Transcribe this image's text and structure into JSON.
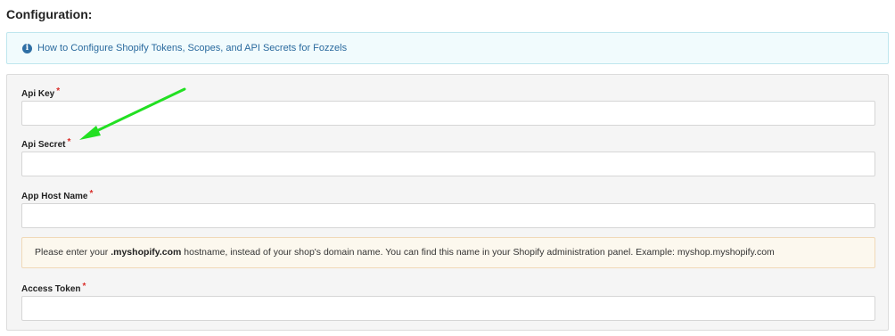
{
  "section": {
    "title": "Configuration:"
  },
  "info": {
    "icon": "info-icon",
    "link_text": "How to Configure Shopify Tokens, Scopes, and API Secrets for Fozzels"
  },
  "fields": {
    "api_key": {
      "label": "Api Key",
      "required_mark": "*",
      "value": ""
    },
    "api_secret": {
      "label": "Api Secret",
      "required_mark": "*",
      "value": ""
    },
    "app_host_name": {
      "label": "App Host Name",
      "required_mark": "*",
      "value": ""
    },
    "access_token": {
      "label": "Access Token",
      "required_mark": "*",
      "value": ""
    }
  },
  "hint": {
    "prefix": "Please enter your ",
    "emphasis": ".myshopify.com",
    "suffix": " hostname, instead of your shop's domain name. You can find this name in your Shopify administration panel. Example: myshop.myshopify.com"
  },
  "colors": {
    "arrow": "#22e022",
    "required": "#d9302c",
    "link": "#2a6a9e"
  }
}
